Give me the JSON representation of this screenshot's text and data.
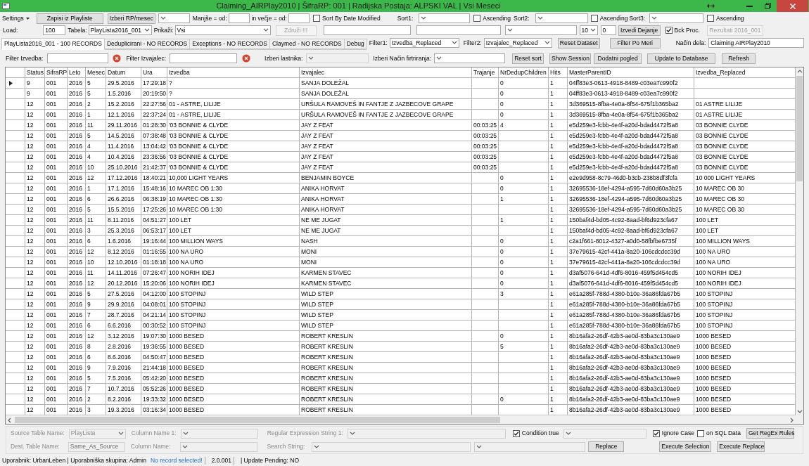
{
  "window": {
    "title": "Claiming_AIRPlay2010 | ŠifraRP: 001 | Radijska Postaja: ALPSKI VAL | Vsi Meseci"
  },
  "toolbar_row_1": [
    {
      "kind": "menu",
      "text": "Settings"
    },
    {
      "kind": "button",
      "text": "Zapisi iz Playliste",
      "disabled": false
    },
    {
      "kind": "button",
      "text": "Izberi RP/mesec",
      "disabled": false
    },
    {
      "kind": "combo",
      "disabled": false
    },
    {
      "kind": "label",
      "text": "Manjše = od:"
    },
    {
      "kind": "input",
      "disabled": false
    },
    {
      "kind": "label",
      "text": "in večje = od:"
    },
    {
      "kind": "input",
      "disabled": false
    },
    {
      "kind": "checkbox",
      "text": "Sort By Date Modified",
      "checked": false
    },
    {
      "kind": "label",
      "text": "Sort1:"
    },
    {
      "kind": "combo",
      "disabled": false
    },
    {
      "kind": "checkbox",
      "text": "Ascending",
      "checked": false
    },
    {
      "kind": "label",
      "text": "Sort2:"
    },
    {
      "kind": "combo",
      "disabled": false
    },
    {
      "kind": "checkbox",
      "text": "Ascending",
      "checked": false
    },
    {
      "kind": "label",
      "text": "Sort3:"
    },
    {
      "kind": "combo",
      "disabled": false
    },
    {
      "kind": "checkbox",
      "text": "Ascending",
      "checked": false
    }
  ],
  "toolbar_row_2": [
    {
      "kind": "label",
      "text": "Load:"
    },
    {
      "kind": "input",
      "text": "100",
      "disabled": false
    },
    {
      "kind": "label",
      "text": "Tabela:"
    },
    {
      "kind": "combo",
      "text": "PlayLista2016_001",
      "disabled": false
    },
    {
      "kind": "label",
      "text": "Prikaži:"
    },
    {
      "kind": "combo",
      "text": "Vsi",
      "disabled": false
    },
    {
      "kind": "button",
      "text": "Združi !!!",
      "disabled": true
    },
    {
      "kind": "input",
      "disabled": false
    },
    {
      "kind": "input",
      "disabled": false
    },
    {
      "kind": "combo",
      "disabled": false
    },
    {
      "kind": "combo",
      "text": "10",
      "disabled": false
    },
    {
      "kind": "input",
      "text": "0",
      "disabled": false
    },
    {
      "kind": "button",
      "text": "Izvedi Dejanje",
      "disabled": false
    },
    {
      "kind": "checkbox",
      "text": "Bck Proc.",
      "checked": true
    },
    {
      "kind": "button",
      "text": "Rezultati 2016_001",
      "disabled": true
    }
  ],
  "tabs": [
    {
      "label": "PlayLista2016_001 - 100 RECORDS",
      "selected": true
    },
    {
      "label": "Deduplicirani - NO RECORDS",
      "selected": false
    },
    {
      "label": "Exceptions - NO RECORDS",
      "selected": false
    },
    {
      "label": "Claymed - NO RECORDS",
      "selected": false
    },
    {
      "label": "Debug",
      "selected": false
    }
  ],
  "toolbar_row_3": [
    {
      "kind": "label",
      "text": "Filter1:"
    },
    {
      "kind": "combo",
      "text": "Izvedba_Replaced",
      "disabled": false
    },
    {
      "kind": "label",
      "text": "Filter2:"
    },
    {
      "kind": "combo",
      "text": "Izvajalec_Replaced",
      "disabled": false
    },
    {
      "kind": "button",
      "text": "Reset Dataset",
      "disabled": false
    },
    {
      "kind": "button",
      "text": "Filter Po Meri",
      "disabled": false
    },
    {
      "kind": "label",
      "text": "Način dela:"
    },
    {
      "kind": "input",
      "text": "Claiming AIRPlay2010",
      "disabled": false
    }
  ],
  "filter_row": [
    {
      "kind": "label",
      "text": "Filter Izvedba:"
    },
    {
      "kind": "input",
      "disabled": false
    },
    {
      "kind": "clear"
    },
    {
      "kind": "label",
      "text": "Filter Izvajalec:"
    },
    {
      "kind": "input",
      "disabled": false
    },
    {
      "kind": "clear"
    },
    {
      "kind": "label",
      "text": "Izberi lastnika:"
    },
    {
      "kind": "combo",
      "disabled": true
    },
    {
      "kind": "label",
      "text": "Izberi Način firtriranja:"
    },
    {
      "kind": "combo",
      "disabled": false
    },
    {
      "kind": "button",
      "text": "Reset sort",
      "disabled": false
    },
    {
      "kind": "button",
      "text": "Show Session",
      "disabled": false
    },
    {
      "kind": "button",
      "text": "Dodatni pogled",
      "disabled": false
    },
    {
      "kind": "button",
      "text": "Update to Database",
      "disabled": false
    },
    {
      "kind": "button",
      "text": "Refresh",
      "disabled": false
    }
  ],
  "grid": {
    "columns": [
      "Status",
      "SifraRP",
      "Leto",
      "Mesec",
      "Datum",
      "Ura",
      "Izvedba",
      "Izvajalec",
      "Trajanje",
      "NrDedupChildren",
      "Hits",
      "MasterParentID",
      "Izvedba_Replaced"
    ],
    "rows": [
      {
        "selected": true,
        "cells": [
          "9",
          "001",
          "2016",
          "5",
          "29.5.2016",
          "17:29:18",
          "?",
          "SANJA DOLEŽAL",
          null,
          "0",
          "1",
          "04ff83e3-0613-4918-8489-c03ea7c990f2",
          null
        ]
      },
      {
        "selected": false,
        "cells": [
          "9",
          "001",
          "2016",
          "5",
          "1.5.2016",
          "20:19:50",
          "?",
          "SANJA DOLEŽAL",
          null,
          "0",
          "1",
          "04ff83e3-0613-4918-8489-c03ea7c990f2",
          null
        ]
      },
      {
        "selected": false,
        "cells": [
          "12",
          "001",
          "2016",
          "2",
          "15.2.2016",
          "22:27:56",
          "01 - ASTRE, LILIJE",
          "URŠULA RAMOVEŠ IN FANTJE Z JAZBECOVE GRAPE",
          null,
          "0",
          "1",
          "3d369515-8fba-4e0a-8f54-675f1b365ba2",
          "01 ASTRE LILIJE"
        ]
      },
      {
        "selected": false,
        "cells": [
          "12",
          "001",
          "2016",
          "1",
          "12.1.2016",
          "22:37:24",
          "01 - ASTRE, LILIJE",
          "URŠULA RAMOVEŠ IN FANTJE Z JAZBECOVE GRAPE",
          null,
          "0",
          "1",
          "3d369515-8fba-4e0a-8f54-675f1b365ba2",
          "01 ASTRE LILIJE"
        ]
      },
      {
        "selected": false,
        "cells": [
          "12",
          "001",
          "2016",
          "11",
          "29.11.2016",
          "01:28:30",
          "'03 BONNIE & CLYDE",
          "JAY Z FEAT",
          "00:03:25",
          "4",
          "1",
          "e5d259e3-fcbb-4e4f-a20d-bdad4472f5a8",
          "03 BONNIE CLYDE"
        ]
      },
      {
        "selected": false,
        "cells": [
          "12",
          "001",
          "2016",
          "5",
          "14.5.2016",
          "07:38:48",
          "'03 BONNIE & CLYDE",
          "JAY Z FEAT",
          "00:03:25",
          null,
          "1",
          "e5d259e3-fcbb-4e4f-a20d-bdad4472f5a8",
          "03 BONNIE CLYDE"
        ]
      },
      {
        "selected": false,
        "cells": [
          "12",
          "001",
          "2016",
          "4",
          "11.4.2016",
          "13:04:42",
          "'03 BONNIE & CLYDE",
          "JAY Z FEAT",
          "00:03:25",
          null,
          "1",
          "e5d259e3-fcbb-4e4f-a20d-bdad4472f5a8",
          "03 BONNIE CLYDE"
        ]
      },
      {
        "selected": false,
        "cells": [
          "12",
          "001",
          "2016",
          "4",
          "10.4.2016",
          "23:36:56",
          "'03 BONNIE & CLYDE",
          "JAY Z FEAT",
          "00:03:25",
          null,
          "1",
          "e5d259e3-fcbb-4e4f-a20d-bdad4472f5a8",
          "03 BONNIE CLYDE"
        ]
      },
      {
        "selected": false,
        "cells": [
          "12",
          "001",
          "2016",
          "10",
          "25.10.2016",
          "21:42:37",
          "'03 BONNIE & CLYDE",
          "JAY Z FEAT",
          "00:03:25",
          null,
          "1",
          "e5d259e3-fcbb-4e4f-a20d-bdad4472f5a8",
          "03 BONNIE CLYDE"
        ]
      },
      {
        "selected": false,
        "cells": [
          "12",
          "001",
          "2016",
          "12",
          "17.12.2016",
          "18:40:21",
          "10,000 LIGHT YEARS",
          "BENJAMIN BOYCE",
          null,
          "0",
          "1",
          "e2e9d958-8c79-46d0-b3cb-238b8df3fcfa",
          "10 000 LIGHT YEARS"
        ]
      },
      {
        "selected": false,
        "cells": [
          "12",
          "001",
          "2016",
          "1",
          "17.1.2016",
          "15:48:16",
          "10 MAREC OB 1:30",
          "ANIKA HORVAT",
          null,
          "0",
          "1",
          "32695536-18ef-4294-a595-7d60d60a3b25",
          "10 MAREC OB 30"
        ]
      },
      {
        "selected": false,
        "cells": [
          "12",
          "001",
          "2016",
          "6",
          "26.6.2016",
          "06:38:19",
          "10 MAREC OB 1:30",
          "ANIKA HORVAT",
          null,
          "1",
          "1",
          "32695536-18ef-4294-a595-7d60d60a3b25",
          "10 MAREC OB 30"
        ]
      },
      {
        "selected": false,
        "cells": [
          "12",
          "001",
          "2016",
          "5",
          "15.5.2016",
          "17:25:26",
          "10 MAREC OB 1:30",
          "ANIKA HORVAT",
          null,
          null,
          "1",
          "32695536-18ef-4294-a595-7d60d60a3b25",
          "10 MAREC OB 30"
        ]
      },
      {
        "selected": false,
        "cells": [
          "12",
          "001",
          "2016",
          "11",
          "8.11.2016",
          "04:51:27",
          "100 LET",
          "NE ME JUGAT",
          null,
          "1",
          "1",
          "150baf4d-bd05-4c92-8aad-bf6d923cfa67",
          "100 LET"
        ]
      },
      {
        "selected": false,
        "cells": [
          "12",
          "001",
          "2016",
          "3",
          "25.3.2016",
          "06:53:17",
          "100 LET",
          "NE ME JUGAT",
          null,
          null,
          "1",
          "150baf4d-bd05-4c92-8aad-bf6d923cfa67",
          "100 LET"
        ]
      },
      {
        "selected": false,
        "cells": [
          "12",
          "001",
          "2016",
          "6",
          "1.6.2016",
          "19:16:44",
          "100 MILLION WAYS",
          "NASH",
          null,
          "0",
          "1",
          "c2a1f661-8012-4327-a0d0-58fbfbe6735f",
          "100 MILLION WAYS"
        ]
      },
      {
        "selected": false,
        "cells": [
          "12",
          "001",
          "2016",
          "12",
          "8.12.2016",
          "01:16:55",
          "100 NA URO",
          "MONI",
          null,
          "0",
          "1",
          "37e79615-42cf-441a-8a20-106cdcdcc39d",
          "100 NA URO"
        ]
      },
      {
        "selected": false,
        "cells": [
          "12",
          "001",
          "2016",
          "10",
          "12.10.2016",
          "01:18:18",
          "100 NA URO",
          "MONI",
          null,
          "0",
          "1",
          "37e79615-42cf-441a-8a20-106cdcdcc39d",
          "100 NA URO"
        ]
      },
      {
        "selected": false,
        "cells": [
          "12",
          "001",
          "2016",
          "11",
          "14.11.2016",
          "07:26:47",
          "100 NORIH IDEJ",
          "KARMEN STAVEC",
          null,
          "0",
          "1",
          "d3af5076-641d-4df6-8016-459f5d454cd5",
          "100 NORIH IDEJ"
        ]
      },
      {
        "selected": false,
        "cells": [
          "12",
          "001",
          "2016",
          "12",
          "20.12.2016",
          "15:20:06",
          "100 NORIH IDEJ",
          "KARMEN STAVEC",
          null,
          "0",
          "1",
          "d3af5076-641d-4df6-8016-459f5d454cd5",
          "100 NORIH IDEJ"
        ]
      },
      {
        "selected": false,
        "cells": [
          "12",
          "001",
          "2016",
          "5",
          "27.5.2016",
          "04:12:00",
          "100 STOPINJ",
          "WILD STEP",
          null,
          "3",
          "1",
          "e61a285f-788d-4380-b10e-36a86fda67b5",
          "100 STOPINJ"
        ]
      },
      {
        "selected": false,
        "cells": [
          "12",
          "001",
          "2016",
          "9",
          "29.9.2016",
          "04:08:01",
          "100 STOPINJ",
          "WILD STEP",
          null,
          null,
          "1",
          "e61a285f-788d-4380-b10e-36a86fda67b5",
          "100 STOPINJ"
        ]
      },
      {
        "selected": false,
        "cells": [
          "12",
          "001",
          "2016",
          "7",
          "28.7.2016",
          "04:21:14",
          "100 STOPINJ",
          "WILD STEP",
          null,
          null,
          "1",
          "e61a285f-788d-4380-b10e-36a86fda67b5",
          "100 STOPINJ"
        ]
      },
      {
        "selected": false,
        "cells": [
          "12",
          "001",
          "2016",
          "6",
          "6.6.2016",
          "00:30:52",
          "100 STOPINJ",
          "WILD STEP",
          null,
          null,
          "1",
          "e61a285f-788d-4380-b10e-36a86fda67b5",
          "100 STOPINJ"
        ]
      },
      {
        "selected": false,
        "cells": [
          "12",
          "001",
          "2016",
          "12",
          "3.12.2016",
          "19:07:30",
          "1000 BESED",
          "ROBERT KRESLIN",
          null,
          "0",
          "1",
          "8b16afa2-26df-42b3-ae0d-83ba3c130ae9",
          "1000 BESED"
        ]
      },
      {
        "selected": false,
        "cells": [
          "12",
          "001",
          "2016",
          "8",
          "2.8.2016",
          "19:36:55",
          "1000 BESED",
          "ROBERT KRESLIN",
          null,
          "5",
          "1",
          "8b16afa2-26df-42b3-ae0d-83ba3c130ae9",
          "1000 BESED"
        ]
      },
      {
        "selected": false,
        "cells": [
          "12",
          "001",
          "2016",
          "6",
          "8.6.2016",
          "04:50:47",
          "1000 BESED",
          "ROBERT KRESLIN",
          null,
          null,
          "1",
          "8b16afa2-26df-42b3-ae0d-83ba3c130ae9",
          "1000 BESED"
        ]
      },
      {
        "selected": false,
        "cells": [
          "12",
          "001",
          "2016",
          "9",
          "7.9.2016",
          "21:44:18",
          "1000 BESED",
          "ROBERT KRESLIN",
          null,
          null,
          "1",
          "8b16afa2-26df-42b3-ae0d-83ba3c130ae9",
          "1000 BESED"
        ]
      },
      {
        "selected": false,
        "cells": [
          "12",
          "001",
          "2016",
          "5",
          "7.5.2016",
          "05:42:20",
          "1000 BESED",
          "ROBERT KRESLIN",
          null,
          null,
          "1",
          "8b16afa2-26df-42b3-ae0d-83ba3c130ae9",
          "1000 BESED"
        ]
      },
      {
        "selected": false,
        "cells": [
          "12",
          "001",
          "2016",
          "7",
          "10.7.2016",
          "05:52:26",
          "1000 BESED",
          "ROBERT KRESLIN",
          null,
          null,
          "1",
          "8b16afa2-26df-42b3-ae0d-83ba3c130ae9",
          "1000 BESED"
        ]
      },
      {
        "selected": false,
        "cells": [
          "12",
          "001",
          "2016",
          "2",
          "8.2.2016",
          "19:33:32",
          "1000 BESED",
          "ROBERT KRESLIN",
          null,
          "0",
          "1",
          "8b16afa2-26df-42b3-ae0d-83ba3c130ae9",
          "1000 BESED"
        ]
      },
      {
        "selected": false,
        "cells": [
          "12",
          "001",
          "2016",
          "3",
          "19.3.2016",
          "03:16:34",
          "1000 BESED",
          "ROBERT KRESLIN",
          null,
          null,
          "1",
          "8b16afa2-26df-42b3-ae0d-83ba3c130ae9",
          "1000 BESED"
        ]
      }
    ]
  },
  "regex_panel_row_1": [
    {
      "kind": "label",
      "text": "Source Table Name:",
      "disabled": true
    },
    {
      "kind": "combo",
      "text": "PlayLista",
      "disabled": true
    },
    {
      "kind": "label",
      "text": "Column Name 1:",
      "disabled": true
    },
    {
      "kind": "combo",
      "disabled": true
    },
    {
      "kind": "label",
      "text": "Regular Expression String 1:",
      "disabled": true
    },
    {
      "kind": "combo",
      "disabled": true
    },
    {
      "kind": "checkbox",
      "text": "Condition true",
      "checked": true
    },
    {
      "kind": "combo",
      "disabled": true
    },
    {
      "kind": "checkbox",
      "text": "Ignore Case",
      "checked": true
    },
    {
      "kind": "checkbox",
      "text": "on SQL Data",
      "checked": false
    },
    {
      "kind": "button",
      "text": "Get RegEx Rules",
      "disabled": false
    }
  ],
  "regex_panel_row_2": [
    {
      "kind": "label",
      "text": "Dest. Table Name:",
      "disabled": true
    },
    {
      "kind": "input",
      "text": "Same_As_Source",
      "disabled": true
    },
    {
      "kind": "label",
      "text": "Column Name:",
      "disabled": true
    },
    {
      "kind": "combo",
      "disabled": true
    },
    {
      "kind": "label",
      "text": "Search String:",
      "disabled": true
    },
    {
      "kind": "combo",
      "disabled": true
    },
    {
      "kind": "combo",
      "disabled": true
    },
    {
      "kind": "button",
      "text": "Replace",
      "disabled": false
    },
    {
      "kind": "button",
      "text": "Execute Selection",
      "disabled": false
    },
    {
      "kind": "button",
      "text": "Execute Replace",
      "disabled": false
    }
  ],
  "status_bar": [
    {
      "kind": "plain",
      "text": "Uporabnik: UrbanLeben | Uporabniška skupina: Admin"
    },
    {
      "kind": "notice",
      "text": "No record selected!"
    },
    {
      "kind": "plain",
      "text": "2.0.001"
    },
    {
      "kind": "plain",
      "text": "| Update Pending: NO"
    }
  ]
}
